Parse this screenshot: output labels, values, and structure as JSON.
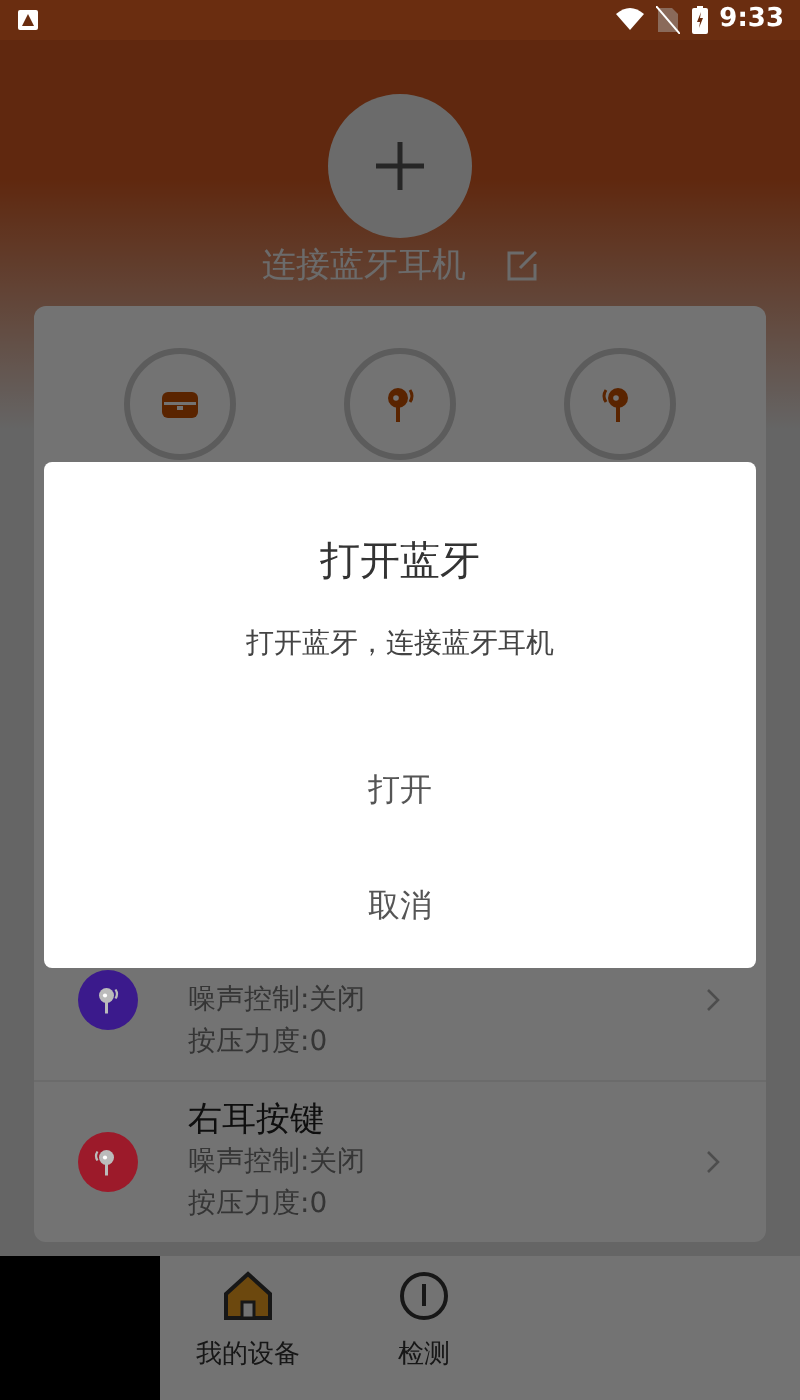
{
  "status_bar": {
    "time": "9:33"
  },
  "header": {
    "title": "连接蓝牙耳机"
  },
  "earbuds": [
    {
      "kind": "case"
    },
    {
      "kind": "left"
    },
    {
      "kind": "right"
    }
  ],
  "keys": [
    {
      "kind": "left",
      "noise": "噪声控制:关闭",
      "pressure": "按压力度:0",
      "color": "#3b1a8c"
    },
    {
      "kind": "right",
      "title": "右耳按键",
      "noise": "噪声控制:关闭",
      "pressure": "按压力度:0",
      "color": "#9c1a2a"
    }
  ],
  "nav": [
    {
      "label": "我的设备",
      "selected": true
    },
    {
      "label": "检测",
      "selected": false
    }
  ],
  "dialog": {
    "title": "打开蓝牙",
    "message": "打开蓝牙，连接蓝牙耳机",
    "buttons": [
      "打开",
      "取消"
    ]
  }
}
